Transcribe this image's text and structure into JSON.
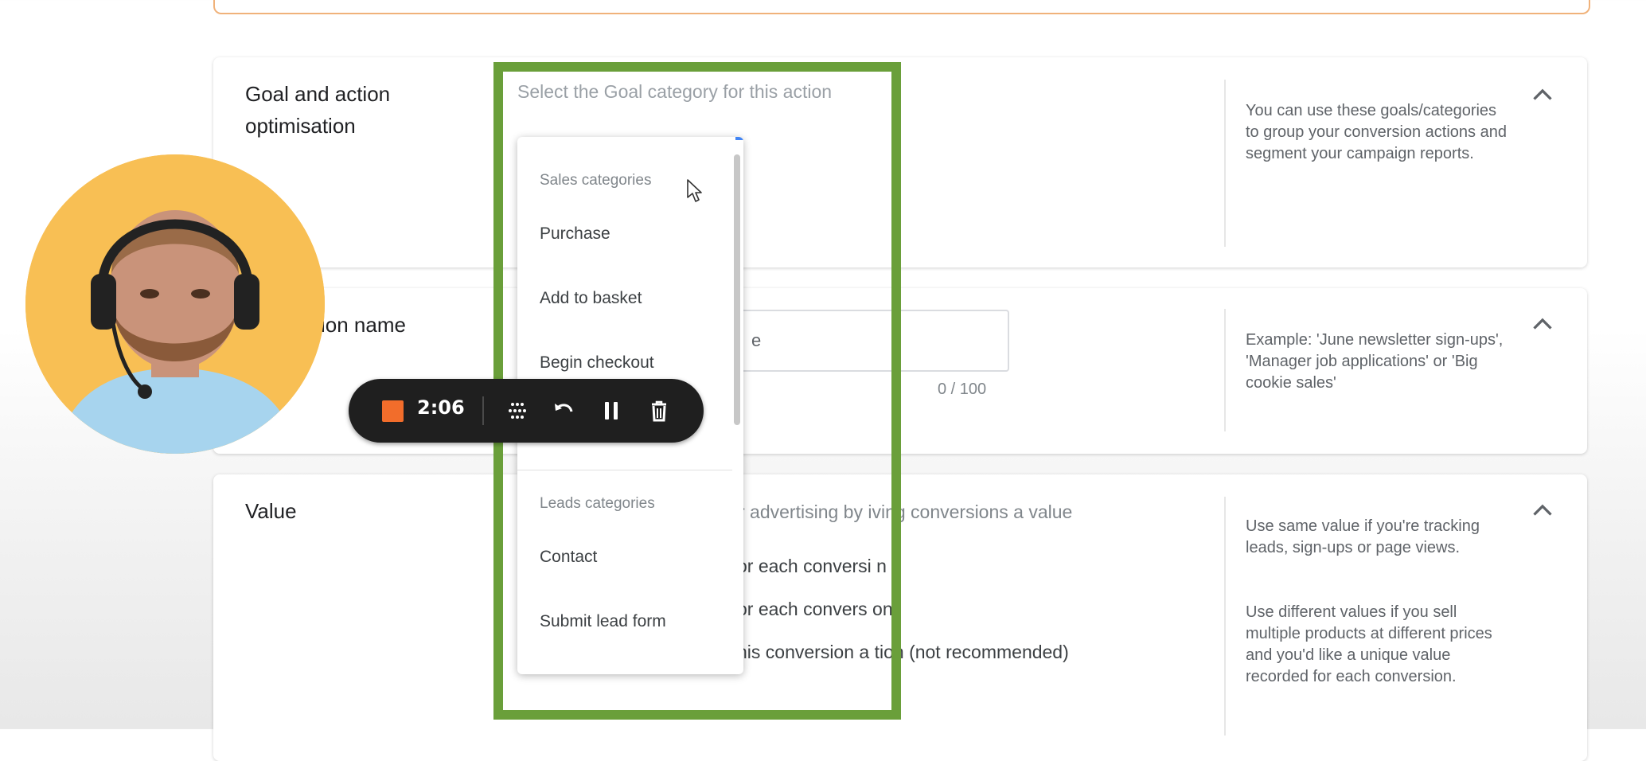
{
  "sections": {
    "goal": {
      "title_line1": "Goal and action",
      "title_line2": "optimisation",
      "subtitle": "Select the Goal category for this action",
      "help": "You can use these goals/categories to group your conversion actions and segment your campaign reports."
    },
    "name": {
      "title_partial": "sion name",
      "input_value_partial": "e",
      "counter": "0 / 100",
      "help": "Example: 'June newsletter sign-ups', 'Manager job applications' or 'Big cookie sales'"
    },
    "value": {
      "title": "Value",
      "subtitle_partial": "r advertising by  iving conversions a value",
      "options_partial": [
        "or each conversi n",
        "or each convers on",
        "his conversion a tion (not recommended)"
      ],
      "help1": "Use same value if you're tracking leads, sign-ups or page views.",
      "help2": "Use different values if you sell multiple products at different prices and you'd like a unique value recorded for each conversion."
    }
  },
  "dropdown": {
    "sales_group": "Sales categories",
    "sales_items": [
      "Purchase",
      "Add to basket",
      "Begin checkout"
    ],
    "leads_group": "Leads categories",
    "leads_items": [
      "Contact",
      "Submit lead form"
    ]
  },
  "recorder": {
    "time": "2:06"
  },
  "colors": {
    "highlight": "#6a9f3a",
    "webcam_bg": "#f8bf54",
    "stop": "#f26d2b",
    "top_border": "#f0b27a"
  },
  "icons": [
    "chevron-up-icon",
    "stop-icon",
    "grid-icon",
    "undo-icon",
    "pause-icon",
    "trash-icon",
    "mouse-cursor-icon"
  ]
}
